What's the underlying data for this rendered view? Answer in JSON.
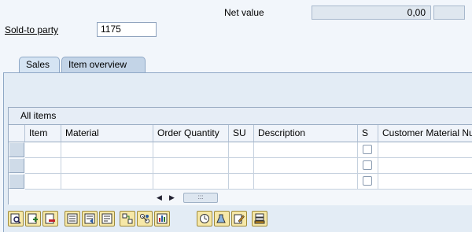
{
  "header": {
    "net_value_label": "Net value",
    "net_value": "0,00",
    "currency": "",
    "sold_to_label": "Sold-to party",
    "sold_to_value": "1175"
  },
  "tabs": [
    {
      "label": "Sales",
      "active": true
    },
    {
      "label": "Item overview",
      "active": false
    }
  ],
  "table": {
    "title": "All items",
    "columns": [
      "Item",
      "Material",
      "Order Quantity",
      "SU",
      "Description",
      "S",
      "Customer Material Nu"
    ],
    "rows": [
      {
        "item": "",
        "material": "",
        "order_quantity": "",
        "su": "",
        "description": "",
        "s_checked": false,
        "customer_material": ""
      },
      {
        "item": "",
        "material": "",
        "order_quantity": "",
        "su": "",
        "description": "",
        "s_checked": false,
        "customer_material": ""
      },
      {
        "item": "",
        "material": "",
        "order_quantity": "",
        "su": "",
        "description": "",
        "s_checked": false,
        "customer_material": ""
      }
    ],
    "scroll_thumb_glyph": ":::"
  },
  "toolbar": {
    "icons": [
      "item-details-icon",
      "create-item-icon",
      "delete-item-icon",
      "select-all-icon",
      "deselect-all-icon",
      "select-block-icon",
      "configuration-icon",
      "schedule-lines-icon",
      "pricing-icon",
      "availability-check-icon",
      "batch-determination-icon",
      "edit-icon",
      "more-functions-icon"
    ]
  },
  "colors": {
    "background": "#f2f6fb",
    "tab_active": "#d5e4f3",
    "panel": "#e3ecf5",
    "toolbar_icon": "#f6e8a8"
  }
}
